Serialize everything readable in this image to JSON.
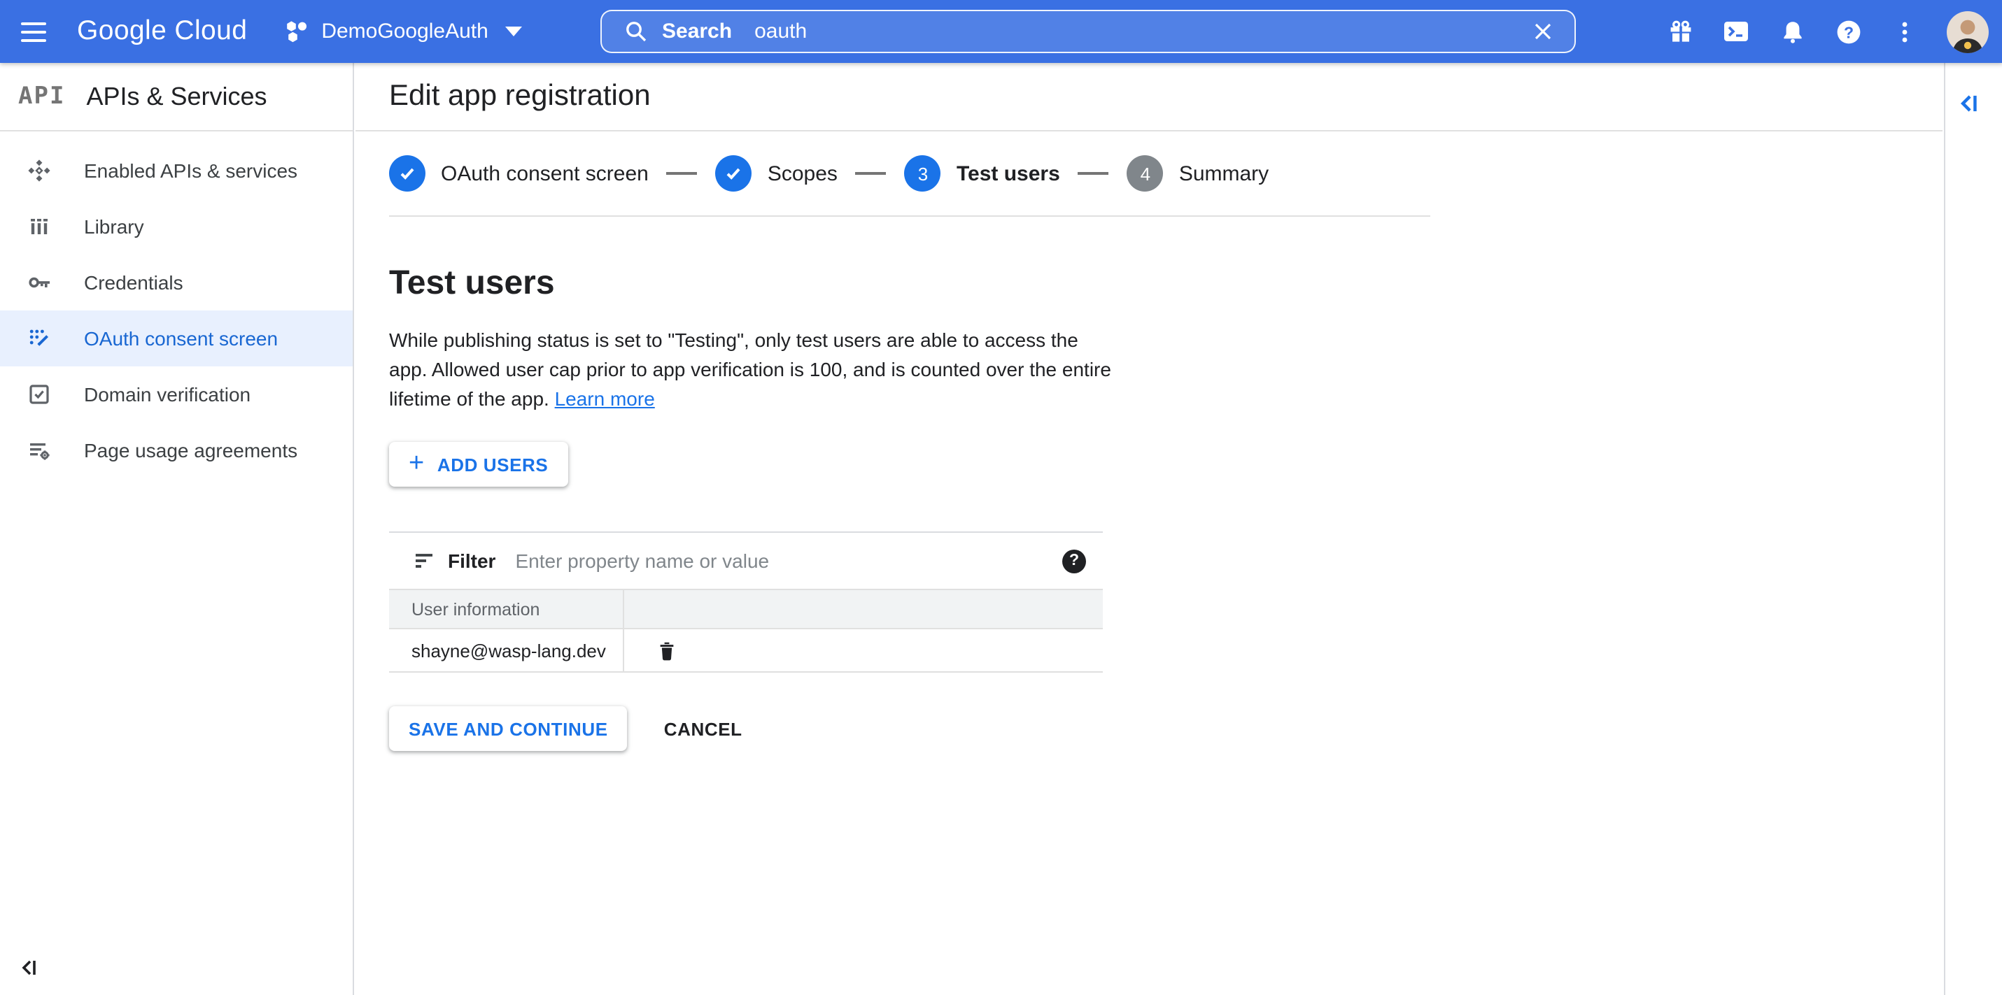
{
  "colors": {
    "topbar": "#3a70e3",
    "accent": "#1a73e8",
    "selected_item_text": "#1967d2",
    "selected_item_bg": "#e8f0fe"
  },
  "topbar": {
    "product": "Google Cloud",
    "project_name": "DemoGoogleAuth",
    "search": {
      "label": "Search",
      "query": "oauth"
    },
    "icons": [
      "menu",
      "search",
      "clear",
      "gift-offers",
      "cloud-shell",
      "notifications-bell",
      "help",
      "more-vert",
      "account-avatar"
    ]
  },
  "sidebar": {
    "logo_text": "API",
    "title": "APIs & Services",
    "items": [
      {
        "label": "Enabled APIs & services",
        "icon": "enabled-apis-icon",
        "selected": false
      },
      {
        "label": "Library",
        "icon": "library-icon",
        "selected": false
      },
      {
        "label": "Credentials",
        "icon": "key-icon",
        "selected": false
      },
      {
        "label": "OAuth consent screen",
        "icon": "consent-screen-icon",
        "selected": true
      },
      {
        "label": "Domain verification",
        "icon": "checkbox-icon",
        "selected": false
      },
      {
        "label": "Page usage agreements",
        "icon": "agreements-icon",
        "selected": false
      }
    ]
  },
  "header": {
    "title": "Edit app registration"
  },
  "stepper": {
    "steps": [
      {
        "label": "OAuth consent screen",
        "state": "complete"
      },
      {
        "label": "Scopes",
        "state": "complete"
      },
      {
        "label": "Test users",
        "number": "3",
        "state": "active"
      },
      {
        "label": "Summary",
        "number": "4",
        "state": "upcoming"
      }
    ]
  },
  "content": {
    "heading": "Test users",
    "description": "While publishing status is set to \"Testing\", only test users are able to access the app. Allowed user cap prior to app verification is 100, and is counted over the entire lifetime of the app.",
    "learn_more_label": "Learn more",
    "add_users_label": "ADD USERS",
    "filter": {
      "label": "Filter",
      "placeholder": "Enter property name or value"
    },
    "table": {
      "columns": [
        "User information",
        ""
      ],
      "rows": [
        {
          "email": "shayne@wasp-lang.dev"
        }
      ]
    },
    "save_label": "SAVE AND CONTINUE",
    "cancel_label": "CANCEL"
  }
}
